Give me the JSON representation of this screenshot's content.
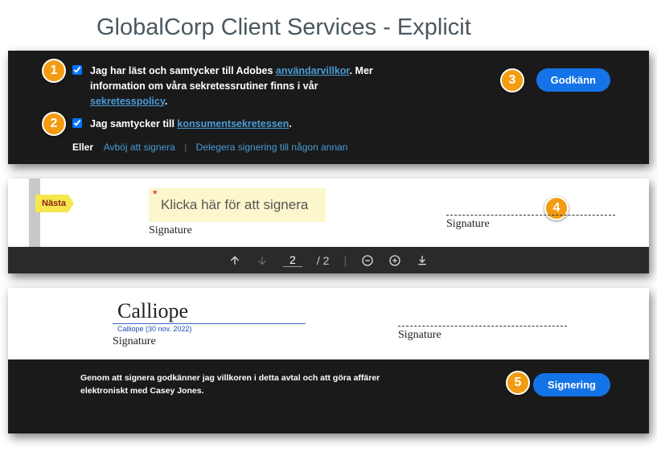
{
  "title": "GlobalCorp Client  Services - Explicit",
  "consent": {
    "row1_part1": "Jag har läst och samtycker till Adobes ",
    "row1_link1": "användarvillkor",
    "row1_part2": ". Mer information om våra sekretessrutiner finns i vår ",
    "row1_link2": "sekretesspolicy",
    "row1_part3": ".",
    "row2_part1": "Jag samtycker till ",
    "row2_link": "konsumentsekretessen",
    "row2_part2": ".",
    "accept_label": "Godkänn",
    "eller": "Eller",
    "decline": "Avböj att signera",
    "delegate": "Delegera signering till någon annan"
  },
  "badges": {
    "b1": "1",
    "b2": "2",
    "b3": "3",
    "b4": "4",
    "b5": "5"
  },
  "signArea": {
    "nasta": "Nästa",
    "placeholder": "Klicka här för att signera",
    "label": "Signature"
  },
  "toolbar": {
    "page_current": "2",
    "page_total": "/ 2"
  },
  "signed": {
    "name": "Calliope",
    "meta": "Calliope   (30 nov. 2022)",
    "label": "Signature"
  },
  "signingBar": {
    "text": "Genom att signera godkänner jag villkoren i detta avtal och att göra affärer elektroniskt med Casey Jones.",
    "button": "Signering"
  }
}
